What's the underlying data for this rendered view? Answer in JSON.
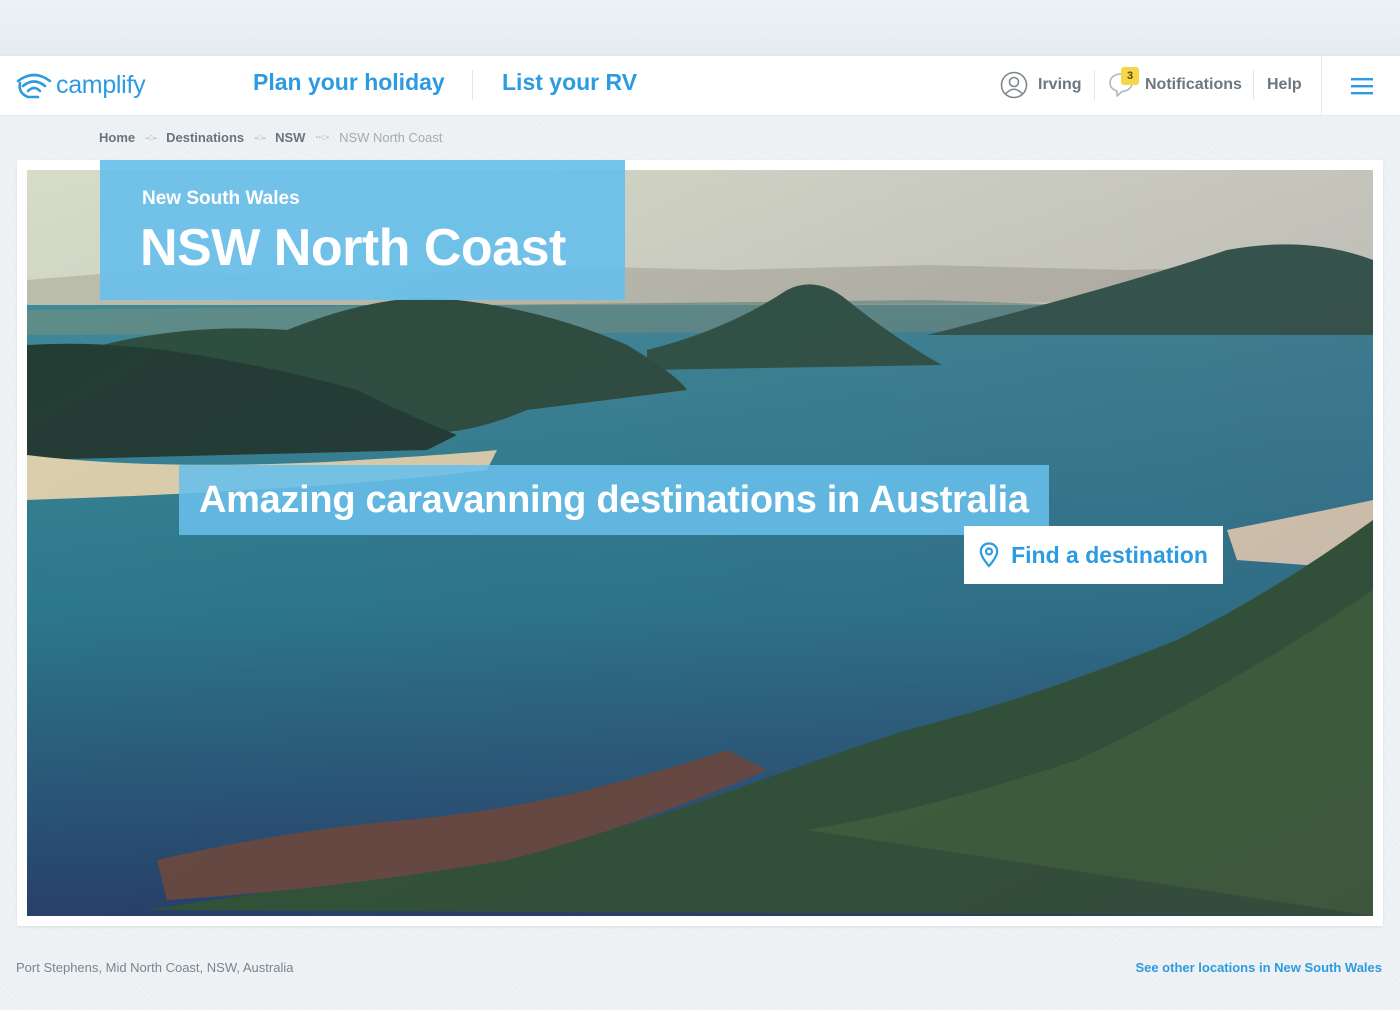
{
  "brand": {
    "name": "camplify",
    "accent": "#2d9be0",
    "hero_overlay": "#68bfeb"
  },
  "header": {
    "nav": [
      {
        "label": "Plan your holiday"
      },
      {
        "label": "List your RV"
      }
    ],
    "user": {
      "name": "Irving",
      "icon": "user-circle-icon"
    },
    "notifications": {
      "label": "Notifications",
      "count": "3",
      "icon": "speech-bubble-icon"
    },
    "help_label": "Help",
    "menu_icon": "hamburger-icon"
  },
  "breadcrumb": [
    {
      "label": "Home"
    },
    {
      "label": "Destinations"
    },
    {
      "label": "NSW"
    },
    {
      "label": "NSW North Coast"
    }
  ],
  "hero": {
    "region": "New South Wales",
    "title": "NSW North Coast",
    "tagline": "Amazing caravanning destinations in Australia",
    "cta_label": "Find a destination",
    "cta_icon": "map-pin-icon"
  },
  "footer": {
    "location": "Port Stephens, Mid North Coast, NSW, Australia",
    "other_link": "See other locations in New South Wales"
  }
}
